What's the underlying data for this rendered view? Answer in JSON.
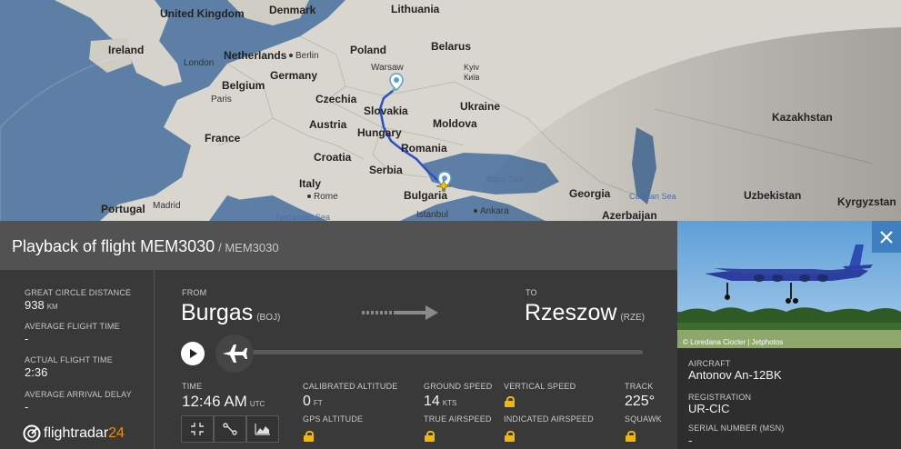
{
  "map": {
    "countries": [
      "United Kingdom",
      "Ireland",
      "Denmark",
      "Lithuania",
      "Netherlands",
      "Poland",
      "Belarus",
      "Belgium",
      "Germany",
      "Czechia",
      "Slovakia",
      "Ukraine",
      "Kyiv",
      "France",
      "Austria",
      "Hungary",
      "Moldova",
      "Romania",
      "Croatia",
      "Serbia",
      "Italy",
      "Bulgaria",
      "Georgia",
      "Kazakhstan",
      "Uzbekistan",
      "Kyrgyzstan",
      "Portugal",
      "Azerbaijan"
    ],
    "cities": [
      "London",
      "Berlin",
      "Paris",
      "Warsaw",
      "Київ",
      "Madrid",
      "Rome",
      "Istanbul",
      "Ankara",
      "Tyrrhenian Sea"
    ],
    "seas": [
      "Black Sea",
      "Caspian Sea"
    ]
  },
  "panel": {
    "title": "Playback of flight MEM3030",
    "subtitle": "/ MEM3030"
  },
  "stats": {
    "great_circle_label": "GREAT CIRCLE DISTANCE",
    "great_circle_value": "938",
    "great_circle_unit": "KM",
    "avg_flight_time_label": "AVERAGE FLIGHT TIME",
    "avg_flight_time_value": "-",
    "actual_flight_time_label": "ACTUAL FLIGHT TIME",
    "actual_flight_time_value": "2:36",
    "avg_arrival_delay_label": "AVERAGE ARRIVAL DELAY",
    "avg_arrival_delay_value": "-"
  },
  "route": {
    "from_label": "FROM",
    "from_city": "Burgas",
    "from_code": "(BOJ)",
    "to_label": "TO",
    "to_city": "Rzeszow",
    "to_code": "(RZE)"
  },
  "playback": {
    "progress": 0
  },
  "metrics": {
    "time_label": "TIME",
    "time_value": "12:46 AM",
    "time_unit": "UTC",
    "cal_alt_label": "CALIBRATED ALTITUDE",
    "cal_alt_value": "0",
    "cal_alt_unit": "FT",
    "gps_alt_label": "GPS ALTITUDE",
    "ground_speed_label": "GROUND SPEED",
    "ground_speed_value": "14",
    "ground_speed_unit": "KTS",
    "true_airspeed_label": "TRUE AIRSPEED",
    "vertical_speed_label": "VERTICAL SPEED",
    "indicated_airspeed_label": "INDICATED AIRSPEED",
    "track_label": "TRACK",
    "track_value": "225°",
    "squawk_label": "SQUAWK"
  },
  "brand": {
    "name": "flightradar",
    "suffix": "24"
  },
  "aircraft": {
    "photo_credit": "© Loredana Ciocler | Jetphotos",
    "aircraft_label": "AIRCRAFT",
    "aircraft_value": "Antonov An-12BK",
    "registration_label": "REGISTRATION",
    "registration_value": "UR-CIC",
    "serial_label": "SERIAL NUMBER (MSN)",
    "serial_value": "-"
  },
  "colors": {
    "accent": "#3d7fc1",
    "lock": "#f2b900",
    "brand_orange": "#f28c00",
    "route_line": "#2b4fc9"
  },
  "icons": [
    "close-icon",
    "play-icon",
    "plane-icon",
    "arrow-right-icon",
    "compress-icon",
    "route-icon",
    "chart-icon",
    "lock-icon"
  ]
}
